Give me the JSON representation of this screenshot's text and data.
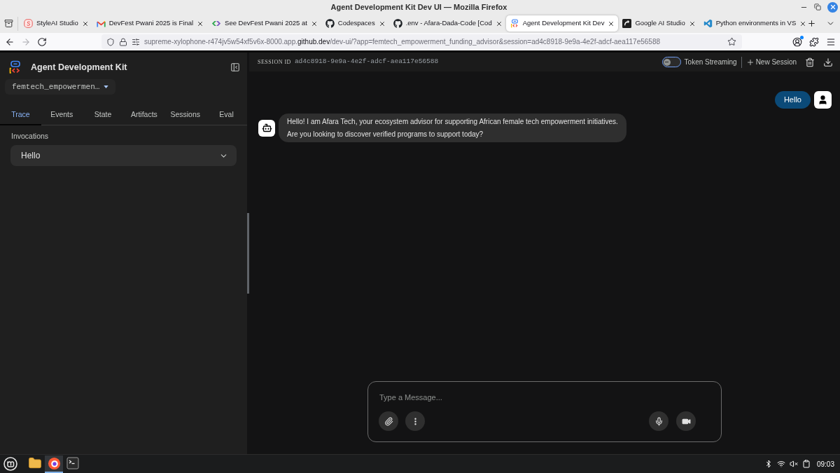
{
  "window": {
    "title": "Agent Development Kit Dev UI — Mozilla Firefox"
  },
  "browser_tabs": [
    {
      "title": "StyleAI Studio",
      "selected": false
    },
    {
      "title": "DevFest Pwani 2025 is Final",
      "selected": false
    },
    {
      "title": "See DevFest Pwani 2025 at",
      "selected": false
    },
    {
      "title": "Codespaces",
      "selected": false
    },
    {
      "title": ".env - Afara-Dada-Code [Cod",
      "selected": false
    },
    {
      "title": "Agent Development Kit Dev",
      "selected": true
    },
    {
      "title": "Google AI Studio",
      "selected": false
    },
    {
      "title": "Python environments in VS",
      "selected": false
    }
  ],
  "navigation": {
    "forward_disabled": true,
    "url": "supreme-xylophone-r474jv5w54xf5v6x-8000.app.**github.dev**/dev-ui/?app=femtech_empowerment_funding_advisor&session=ad4c8918-9e9a-4e2f-adcf-aea117e56588"
  },
  "sidebar": {
    "title": "Agent Development Kit",
    "app_selector": "femtech_empowermen…",
    "tabs": [
      {
        "label": "Trace",
        "selected": true
      },
      {
        "label": "Events",
        "selected": false
      },
      {
        "label": "State",
        "selected": false
      },
      {
        "label": "Artifacts",
        "selected": false
      },
      {
        "label": "Sessions",
        "selected": false
      },
      {
        "label": "Eval",
        "selected": false
      }
    ],
    "invocations_label": "Invocations",
    "invocations": [
      {
        "label": "Hello",
        "expanded": false
      }
    ]
  },
  "header": {
    "session_label": "SESSION ID",
    "session_id": "ad4c8918-9e9a-4e2f-adcf-aea117e56588",
    "token_streaming": {
      "label": "Token Streaming",
      "on": false
    },
    "new_session": "New Session"
  },
  "messages": [
    {
      "kind": "user",
      "text": "Hello"
    },
    {
      "kind": "agent",
      "text": "Hello! I am Afara Tech, your ecosystem advisor for supporting African female tech empowerment initiatives.\nAre you looking to discover verified programs to support today?"
    }
  ],
  "composer": {
    "placeholder": "Type a Message..."
  },
  "taskbar": {
    "apps": [
      {
        "active": false
      },
      {
        "active": true
      },
      {
        "active": false
      }
    ],
    "clock": "09:03"
  }
}
